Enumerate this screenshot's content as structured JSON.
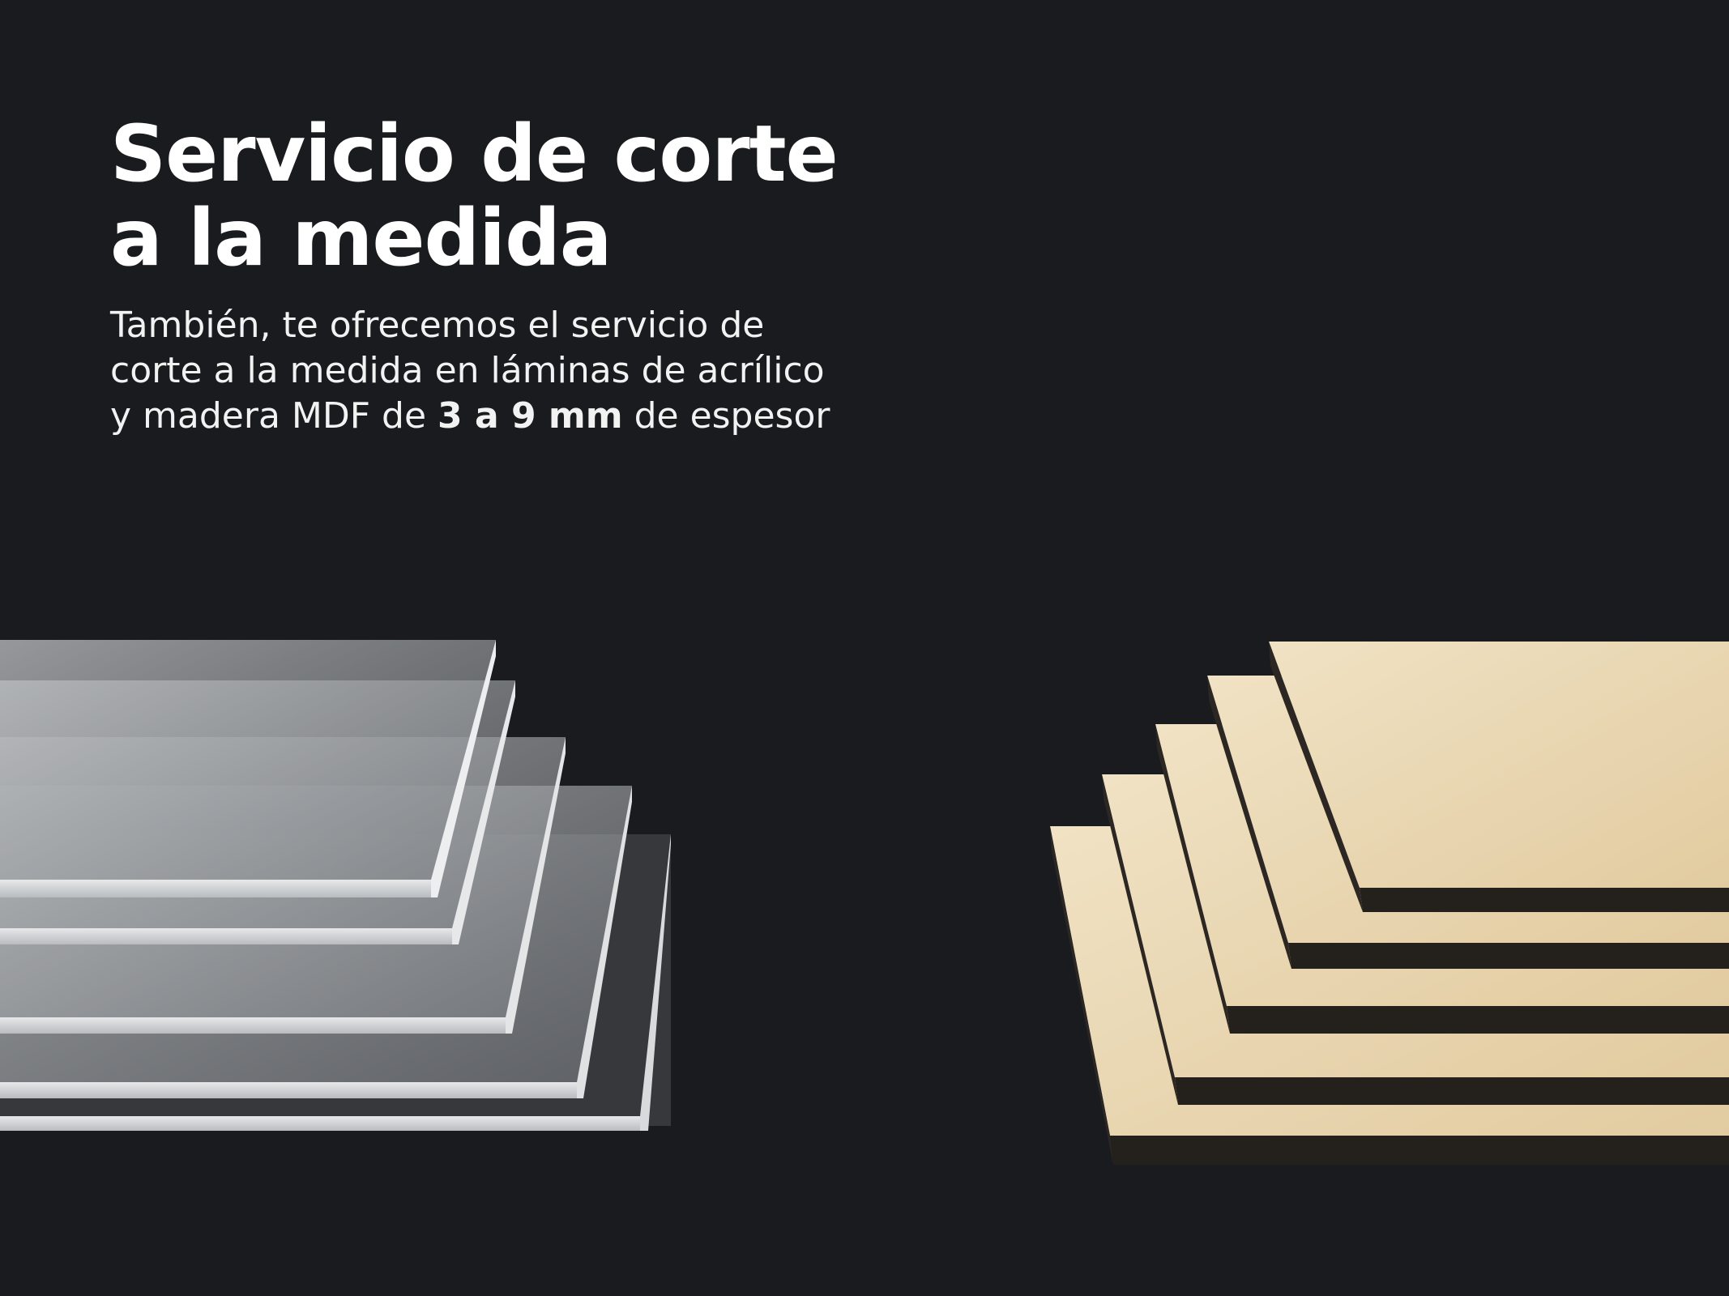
{
  "hero": {
    "title_line1": "Servicio de corte",
    "title_line2": "a la medida",
    "desc_line1": "También, te ofrecemos el servicio de",
    "desc_line2": "corte a la medida en láminas de acrílico",
    "desc_line3_prefix": "y madera MDF de ",
    "desc_line3_bold": "3 a 9 mm",
    "desc_line3_suffix": " de espesor"
  },
  "colors": {
    "background": "#1a1b1e",
    "acrylic": "#c9cccf",
    "mdf_face": "#ead7b3",
    "mdf_edge": "#2a2520"
  },
  "images": {
    "acrylic": "acrylic-sheets-stack",
    "mdf": "mdf-boards-stack"
  }
}
